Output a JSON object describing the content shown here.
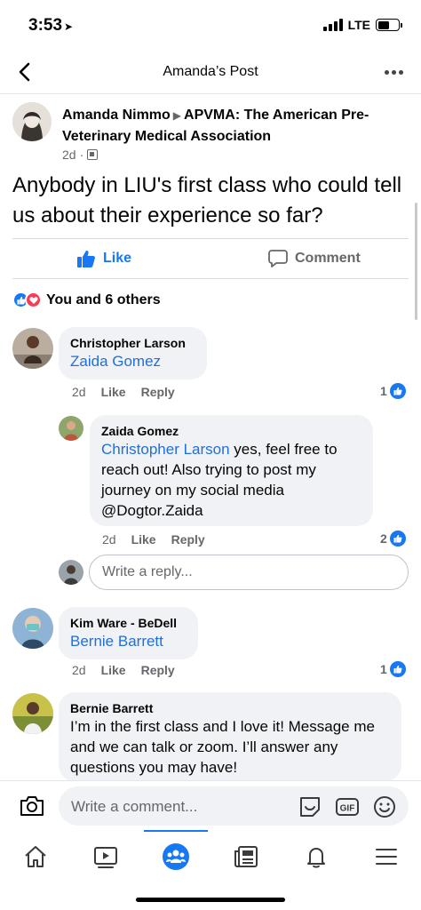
{
  "status": {
    "time": "3:53",
    "network": "LTE"
  },
  "header": {
    "title": "Amanda’s Post"
  },
  "post": {
    "author": "Amanda Nimmo",
    "group": "APVMA: The American Pre-Veterinary Medical Association",
    "age": "2d",
    "text": "Anybody in LIU's first class who could tell us about their experience so far?",
    "like_label": "Like",
    "comment_label": "Comment",
    "reactions_text": "You and 6 others"
  },
  "comments": [
    {
      "name": "Christopher Larson",
      "tag": "Zaida Gomez",
      "body": "",
      "age": "2d",
      "like": "Like",
      "reply": "Reply",
      "likes": "1"
    },
    {
      "name": "Zaida Gomez",
      "tag": "Christopher Larson",
      "body": " yes, feel free to reach out! Also trying to post my journey on my social media @Dogtor.Zaida",
      "age": "2d",
      "like": "Like",
      "reply": "Reply",
      "likes": "2"
    },
    {
      "name": "Kim Ware - BeDell",
      "tag": "Bernie Barrett",
      "body": "",
      "age": "2d",
      "like": "Like",
      "reply": "Reply",
      "likes": "1"
    },
    {
      "name": "Bernie Barrett",
      "tag": "",
      "body": "I’m in the first class and I love it! Message me and we can talk or zoom. I’ll answer any questions you may have!"
    }
  ],
  "reply_placeholder": "Write a reply...",
  "comment_placeholder": "Write a comment...",
  "gif_label": "GIF",
  "colors": {
    "accent": "#1877f2",
    "love": "#f33e58",
    "bubble": "#f0f2f5",
    "secondary_text": "#65676b"
  }
}
